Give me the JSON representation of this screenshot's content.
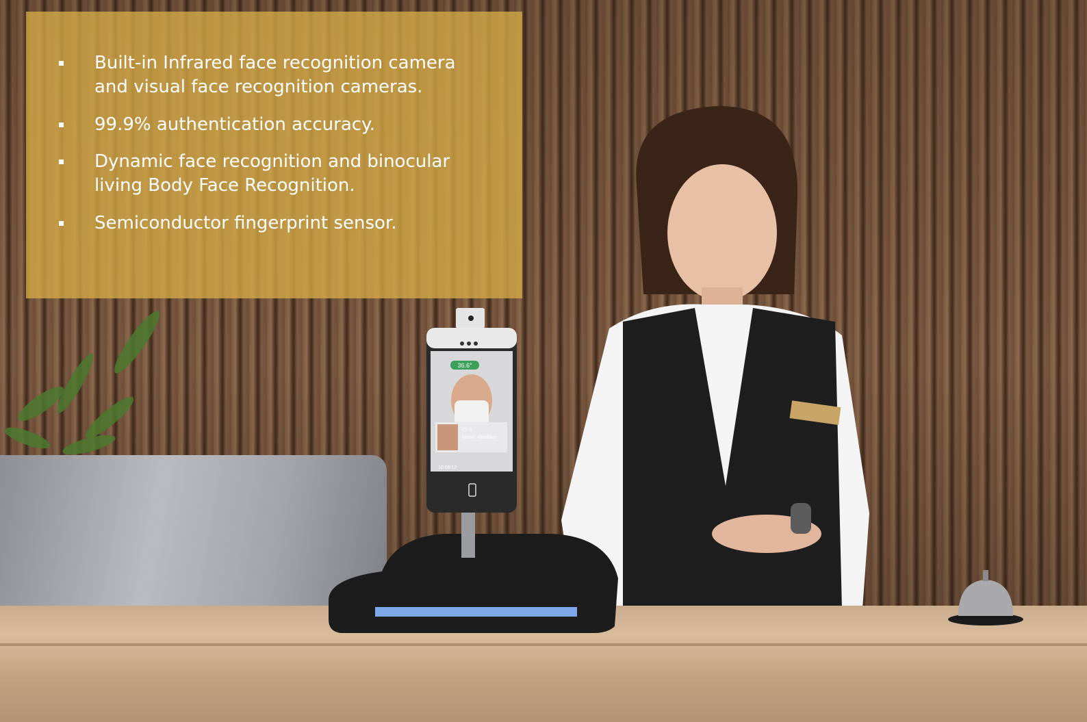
{
  "bullets": [
    {
      "text": "Built-in Infrared face recognition camera and visual face recognition cameras."
    },
    {
      "text": "99.9% authentication accuracy."
    },
    {
      "text": "Dynamic face recognition and binocular living Body Face Recognition."
    },
    {
      "text": "Semiconductor fingerprint sensor."
    }
  ],
  "device_screen": {
    "temperature": "36.6°",
    "id_label": "ID: 5",
    "name_label": "Name: Abraham",
    "time": "10:06:12"
  },
  "colors": {
    "panel": "#d6aa46",
    "bullet_text": "#ffffff",
    "device_led": "#7fa8ea"
  }
}
